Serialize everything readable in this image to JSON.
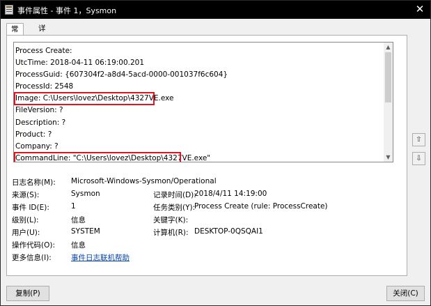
{
  "window": {
    "title": "事件属性 - 事件 1，Sysmon",
    "close_glyph": "✕"
  },
  "tabs": [
    {
      "label": "常规"
    },
    {
      "label": "详细信息"
    }
  ],
  "description_lines": [
    "Process Create:",
    "UtcTime: 2018-04-11 06:19:00.201",
    "ProcessGuid: {607304f2-a8d4-5acd-0000-001037f6c604}",
    "ProcessId: 2548",
    "Image: C:\\Users\\lovez\\Desktop\\4327VE.exe",
    "FileVersion: ?",
    "Description: ?",
    "Product: ?",
    "Company: ?",
    "CommandLine: \"C:\\Users\\lovez\\Desktop\\4327VE.exe\""
  ],
  "highlight_color": "#e0141e",
  "details": {
    "log_name_label": "日志名称(M):",
    "log_name_value": "Microsoft-Windows-Sysmon/Operational",
    "source_label": "来源(S):",
    "source_value": "Sysmon",
    "logged_label": "记录时间(D):",
    "logged_value": "2018/4/11 14:19:00",
    "event_id_label": "事件 ID(E):",
    "event_id_value": "1",
    "task_category_label": "任务类别(Y):",
    "task_category_value": "Process Create (rule: ProcessCreate)",
    "level_label": "级别(L):",
    "level_value": "信息",
    "keywords_label": "关键字(K):",
    "keywords_value": "",
    "user_label": "用户(U):",
    "user_value": "SYSTEM",
    "computer_label": "计算机(R):",
    "computer_value": "DESKTOP-0QSQAI1",
    "opcode_label": "操作代码(O):",
    "opcode_value": "信息",
    "more_info_label": "更多信息(I):",
    "more_info_link": "事件日志联机帮助"
  },
  "buttons": {
    "copy": "复制(P)",
    "close": "关闭(C)"
  }
}
